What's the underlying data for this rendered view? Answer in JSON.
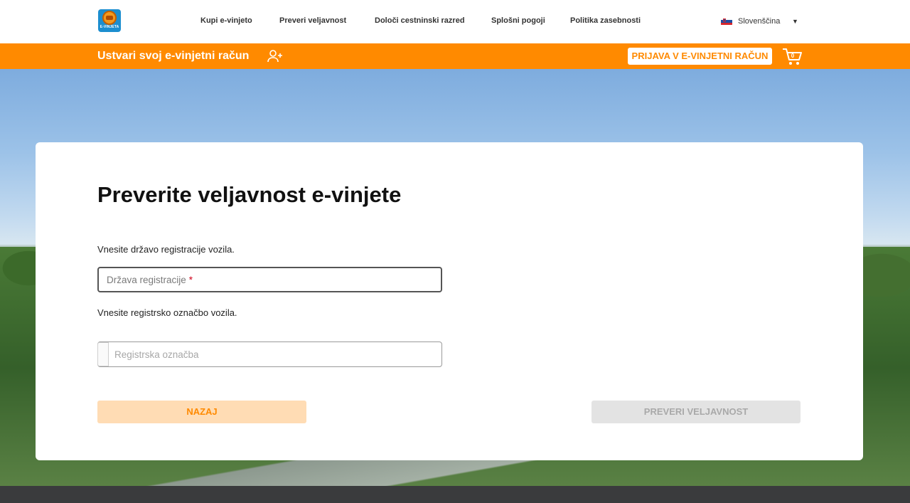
{
  "header": {
    "logo_text": "E-VINJETA",
    "nav": [
      {
        "label": "Kupi e-vinjeto"
      },
      {
        "label": "Preveri veljavnost"
      },
      {
        "label": "Določi cestninski razred"
      },
      {
        "label": "Splošni pogoji"
      },
      {
        "label": "Politika zasebnosti"
      }
    ],
    "language": {
      "label": "Slovenščina",
      "icon": "slovenia-flag-icon"
    }
  },
  "account_bar": {
    "create_account_label": "Ustvari svoj e-vinjetni račun",
    "create_account_icon": "add-user-icon",
    "login_label": "PRIJAVA V E-VINJETNI RAČUN",
    "cart_icon": "cart-icon",
    "cart_count": "0",
    "accent_color": "#ff8a00"
  },
  "form": {
    "title": "Preverite veljavnost e-vinjete",
    "country_prompt": "Vnesite državo registracije vozila.",
    "country_placeholder": "Država registracije",
    "country_required_mark": "*",
    "plate_prompt": "Vnesite registrsko označbo vozila.",
    "plate_placeholder": "Registrska označba",
    "back_label": "NAZAJ",
    "check_label": "PREVERI VELJAVNOST"
  }
}
